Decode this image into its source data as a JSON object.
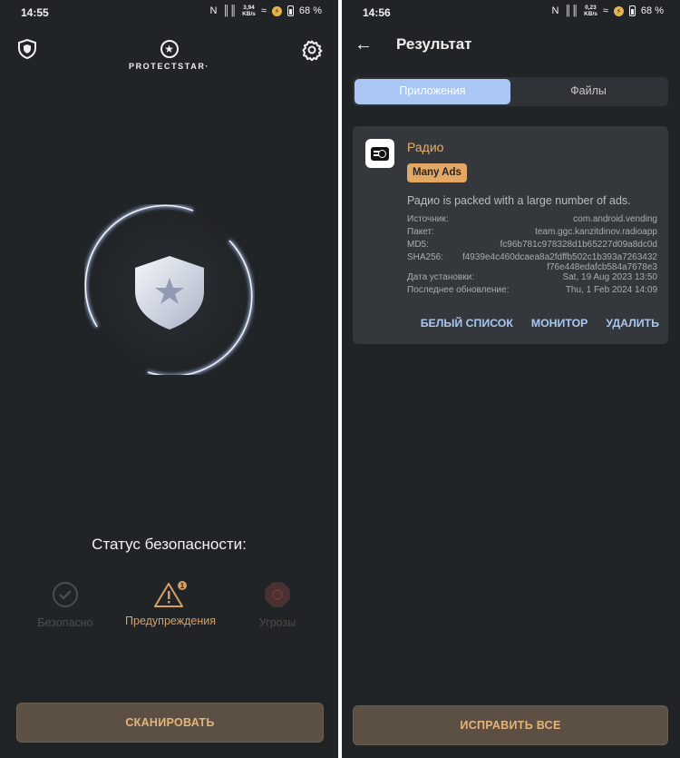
{
  "left": {
    "statusbar": {
      "time": "14:55",
      "nfc": "N",
      "signal": "║║",
      "speed_value": "3,94",
      "speed_unit": "KB/s",
      "wifi": "≈",
      "battery": "68 %"
    },
    "header": {
      "logo_text": "PROTECTSTAR·",
      "shield_icon": "shield-icon",
      "settings_icon": "gear-icon"
    },
    "status_title": "Статус безопасности:",
    "tabs": [
      {
        "label": "Безопасно",
        "icon": "check-circle-icon",
        "active": false
      },
      {
        "label": "Предупреждения",
        "icon": "warning-triangle-icon",
        "active": true,
        "count": "1"
      },
      {
        "label": "Угрозы",
        "icon": "threat-octagon-icon",
        "active": false
      }
    ],
    "scan_button": "СКАНИРОВАТЬ",
    "colors": {
      "accent": "#e5b479",
      "button_bg": "#5c5044",
      "bg": "#212427"
    }
  },
  "right": {
    "statusbar": {
      "time": "14:56",
      "nfc": "N",
      "signal": "║║",
      "speed_value": "0,23",
      "speed_unit": "KB/s",
      "wifi": "≈",
      "battery": "68 %"
    },
    "title": "Результат",
    "segments": [
      {
        "label": "Приложения",
        "active": true
      },
      {
        "label": "Файлы",
        "active": false
      }
    ],
    "card": {
      "app_name": "Радио",
      "badge": "Many Ads",
      "description": "Радио is packed with a large number of ads.",
      "details": [
        {
          "key": "Источник:",
          "value": "com.android.vending"
        },
        {
          "key": "Пакет:",
          "value": "team.ggc.kanzitdinov.radioapp"
        },
        {
          "key": "MD5:",
          "value": "fc96b781c978328d1b65227d09a8dc0d"
        },
        {
          "key": "SHA256:",
          "value": "f4939e4c460dcaea8a2fdffb502c1b393a7263432",
          "value2": "f76e448edafcb584a7678e3"
        },
        {
          "key": "Дата установки:",
          "value": "Sat, 19 Aug 2023 13:50"
        },
        {
          "key": "Последнее обновление:",
          "value": "Thu, 1 Feb 2024 14:09"
        }
      ],
      "actions": [
        "БЕЛЫЙ СПИСОК",
        "МОНИТОР",
        "УДАЛИТЬ"
      ]
    },
    "fix_button": "ИСПРАВИТЬ ВСЕ"
  }
}
